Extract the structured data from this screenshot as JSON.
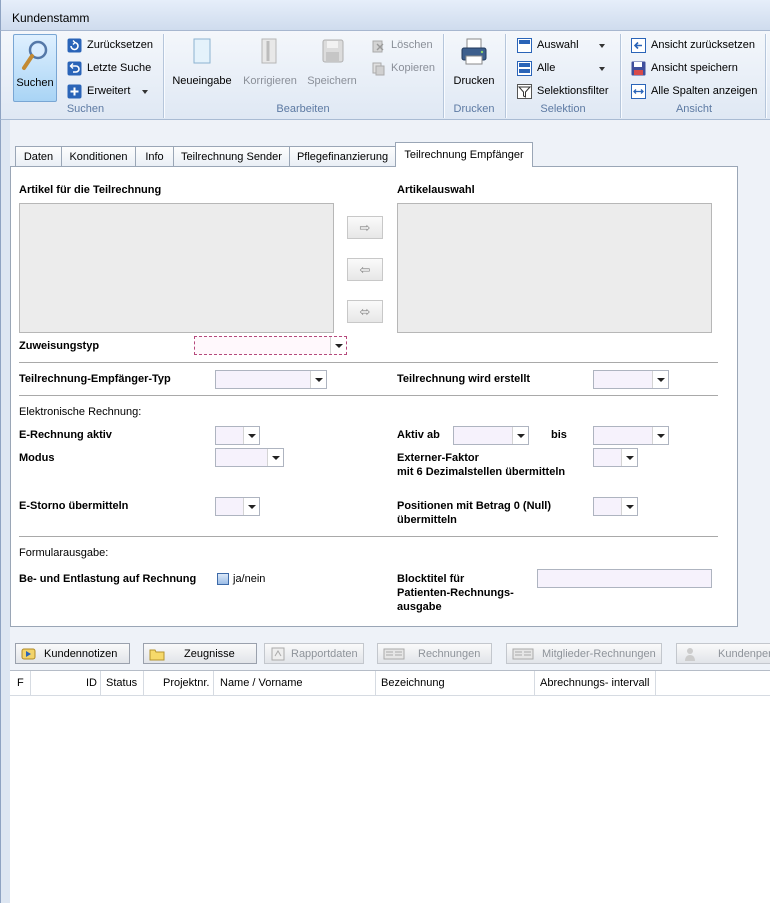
{
  "window": {
    "title": "Kundenstamm"
  },
  "ribbon": {
    "suchen": {
      "group_label": "Suchen",
      "search_label": "Suchen",
      "reset_label": "Zurücksetzen",
      "last_search_label": "Letzte Suche",
      "extended_label": "Erweitert"
    },
    "bearbeiten": {
      "group_label": "Bearbeiten",
      "new_label": "Neueingabe",
      "correct_label": "Korrigieren",
      "save_label": "Speichern",
      "delete_label": "Löschen",
      "copy_label": "Kopieren"
    },
    "drucken": {
      "group_label": "Drucken",
      "print_label": "Drucken"
    },
    "selektion": {
      "group_label": "Selektion",
      "auswahl_label": "Auswahl",
      "alle_label": "Alle",
      "filter_label": "Selektionsfilter"
    },
    "ansicht": {
      "group_label": "Ansicht",
      "reset_view_label": "Ansicht zurücksetzen",
      "save_view_label": "Ansicht speichern",
      "show_all_cols_label": "Alle Spalten anzeigen"
    }
  },
  "tabs": [
    {
      "label": "Daten"
    },
    {
      "label": "Konditionen"
    },
    {
      "label": "Info"
    },
    {
      "label": "Teilrechnung Sender"
    },
    {
      "label": "Pflegefinanzierung"
    },
    {
      "label": "Teilrechnung Empfänger",
      "active": true
    }
  ],
  "form": {
    "articles_label": "Artikel für die Teilrechnung",
    "selection_label": "Artikelauswahl",
    "assign_type_label": "Zuweisungstyp",
    "receiver_type_label": "Teilrechnung-Empfänger-Typ",
    "created_label": "Teilrechnung wird erstellt",
    "e_invoice_section": "Elektronische Rechnung:",
    "e_invoice_active_label": "E-Rechnung aktiv",
    "active_from_label": "Aktiv ab",
    "until_label": "bis",
    "mode_label": "Modus",
    "ext_factor_label_1": "Externer-Faktor",
    "ext_factor_label_2": "mit 6 Dezimalstellen übermitteln",
    "storno_label": "E-Storno übermitteln",
    "null_pos_label_1": "Positionen mit Betrag 0 (Null)",
    "null_pos_label_2": "übermitteln",
    "form_output_section": "Formularausgabe:",
    "relief_label": "Be- und Entlastung auf Rechnung",
    "relief_checkbox_label": "ja/nein",
    "block_title_label_1": "Blocktitel für",
    "block_title_label_2": "Patienten-Rechnungs-",
    "block_title_label_3": "ausgabe",
    "arrow_right": "⇨",
    "arrow_left": "⇦",
    "arrow_both": "⬄"
  },
  "bottom_buttons": {
    "notes": "Kundennotizen",
    "certificates": "Zeugnisse",
    "reports": "Rapportdaten",
    "invoices": "Rechnungen",
    "member_invoices": "Mitglieder-Rechnungen",
    "customer": "Kundenper"
  },
  "grid": {
    "columns": [
      "F",
      "ID",
      "Status",
      "Projektnr.",
      "Name / Vorname",
      "Bezeichnung",
      "Abrechnungs- intervall"
    ]
  },
  "colors": {
    "accent": "#5d7aa3",
    "tab_border": "#9aa6b6",
    "focus_border": "#b54a7c"
  }
}
